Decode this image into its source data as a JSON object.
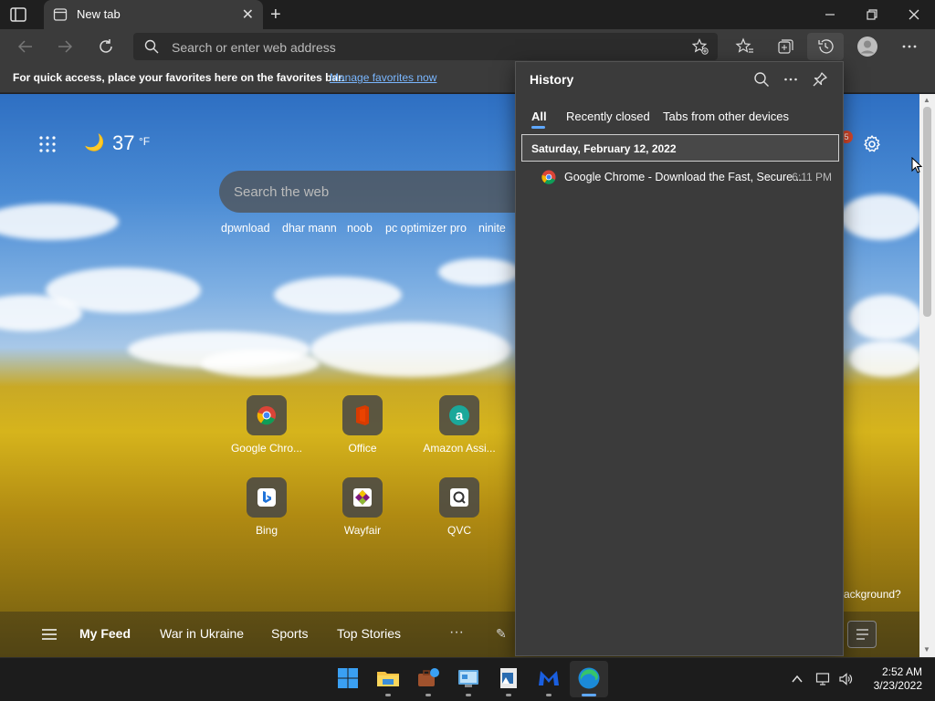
{
  "window": {
    "tab_title": "New tab",
    "tab_close": "✕",
    "new_tab": "+"
  },
  "toolbar": {
    "address_placeholder": "Search or enter web address"
  },
  "favorites_bar": {
    "message": "For quick access, place your favorites here on the favorites bar.",
    "manage_link": "Manage favorites now"
  },
  "newtab": {
    "weather": {
      "temp": "37",
      "unit": "°F",
      "icon": "moon-icon"
    },
    "search_placeholder": "Search the web",
    "chips": [
      "dpwnload",
      "dhar mann",
      "noob",
      "pc optimizer pro",
      "ninite"
    ],
    "tiles": [
      {
        "label": "Google Chro...",
        "icon": "chrome-icon"
      },
      {
        "label": "Office",
        "icon": "office-icon"
      },
      {
        "label": "Amazon Assi...",
        "icon": "amazon-icon"
      },
      {
        "label": "Bing",
        "icon": "bing-icon"
      },
      {
        "label": "Wayfair",
        "icon": "wayfair-icon"
      },
      {
        "label": "QVC",
        "icon": "qvc-icon"
      }
    ],
    "notification_count": "5",
    "background_question": "ackground?",
    "feed": {
      "tabs": [
        "My Feed",
        "War in Ukraine",
        "Sports",
        "Top Stories"
      ],
      "more": "···",
      "edit": "✎"
    }
  },
  "history": {
    "title": "History",
    "tabs": [
      "All",
      "Recently closed",
      "Tabs from other devices"
    ],
    "active_tab": "All",
    "groups": [
      {
        "date": "Saturday, February 12, 2022",
        "items": [
          {
            "title": "Google Chrome - Download the Fast, Secure...",
            "time": "6:11 PM"
          }
        ]
      }
    ]
  },
  "taskbar": {
    "clock_time": "2:52 AM",
    "clock_date": "3/23/2022"
  },
  "colors": {
    "accent": "#5fa8ff",
    "link": "#7ab7ff",
    "panel": "#3b3b3b"
  }
}
